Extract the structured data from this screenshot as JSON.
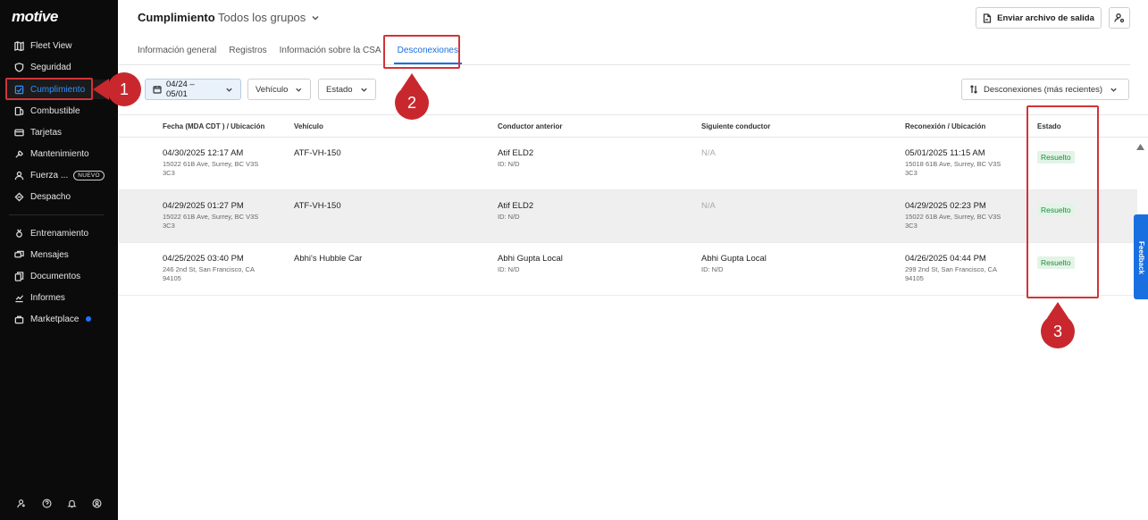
{
  "sidebar": {
    "logo": "motive",
    "items": [
      {
        "label": "Fleet View",
        "icon": "map-icon"
      },
      {
        "label": "Seguridad",
        "icon": "shield-icon"
      },
      {
        "label": "Cumplimiento",
        "icon": "compliance-icon"
      },
      {
        "label": "Combustible",
        "icon": "fuel-icon"
      },
      {
        "label": "Tarjetas",
        "icon": "card-icon"
      },
      {
        "label": "Mantenimiento",
        "icon": "wrench-icon"
      },
      {
        "label": "Fuerza ...",
        "icon": "person-icon",
        "badge": "NUEVO"
      },
      {
        "label": "Despacho",
        "icon": "dispatch-icon"
      },
      {
        "label": "Entrenamiento",
        "icon": "medal-icon"
      },
      {
        "label": "Mensajes",
        "icon": "messages-icon"
      },
      {
        "label": "Documentos",
        "icon": "documents-icon"
      },
      {
        "label": "Informes",
        "icon": "reports-icon"
      },
      {
        "label": "Marketplace",
        "icon": "bag-icon"
      }
    ]
  },
  "header": {
    "title": "Cumplimiento",
    "group": "Todos los grupos",
    "export_label": "Enviar archivo de salida"
  },
  "tabs": [
    {
      "label": "Información general"
    },
    {
      "label": "Registros"
    },
    {
      "label": "Información sobre la CSA"
    },
    {
      "label": "Desconexiones"
    }
  ],
  "filters": {
    "date": "04/24 – 05/01",
    "vehicle": "Vehículo",
    "status": "Estado",
    "sort": "Desconexiones (más recientes)"
  },
  "table": {
    "headers": {
      "date": "Fecha (MDA CDT ) / Ubicación",
      "vehicle": "Vehículo",
      "prev_driver": "Conductor anterior",
      "next_driver": "Siguiente conductor",
      "reconnect": "Reconexión / Ubicación",
      "status": "Estado"
    },
    "rows": [
      {
        "date": "04/30/2025 12:17 AM",
        "loc1": "15022 61B Ave, Surrey, BC V3S",
        "loc2": "3C3",
        "vehicle": "ATF-VH-150",
        "prev_driver": "Atif ELD2",
        "prev_id": "ID: N/D",
        "next_driver": "N/A",
        "next_id": "",
        "reconnect": "05/01/2025 11:15 AM",
        "rloc1": "15018 61B Ave, Surrey, BC V3S",
        "rloc2": "3C3",
        "status": "Resuelto"
      },
      {
        "date": "04/29/2025 01:27 PM",
        "loc1": "15022 61B Ave, Surrey, BC V3S",
        "loc2": "3C3",
        "vehicle": "ATF-VH-150",
        "prev_driver": "Atif ELD2",
        "prev_id": "ID: N/D",
        "next_driver": "N/A",
        "next_id": "",
        "reconnect": "04/29/2025 02:23 PM",
        "rloc1": "15022 61B Ave, Surrey, BC V3S",
        "rloc2": "3C3",
        "status": "Resuelto"
      },
      {
        "date": "04/25/2025 03:40 PM",
        "loc1": "246 2nd St, San Francisco, CA",
        "loc2": "94105",
        "vehicle": "Abhi's Hubble Car",
        "prev_driver": "Abhi Gupta Local",
        "prev_id": "ID: N/D",
        "next_driver": "Abhi Gupta Local",
        "next_id": "ID: N/D",
        "reconnect": "04/26/2025 04:44 PM",
        "rloc1": "299 2nd St, San Francisco, CA",
        "rloc2": "94105",
        "status": "Resuelto"
      }
    ]
  },
  "feedback": "Feedback",
  "callouts": [
    "1",
    "2",
    "3"
  ],
  "colors": {
    "accent": "#1a6fe0",
    "annotation": "#c8282d",
    "status_green": "#1e8e3e"
  }
}
